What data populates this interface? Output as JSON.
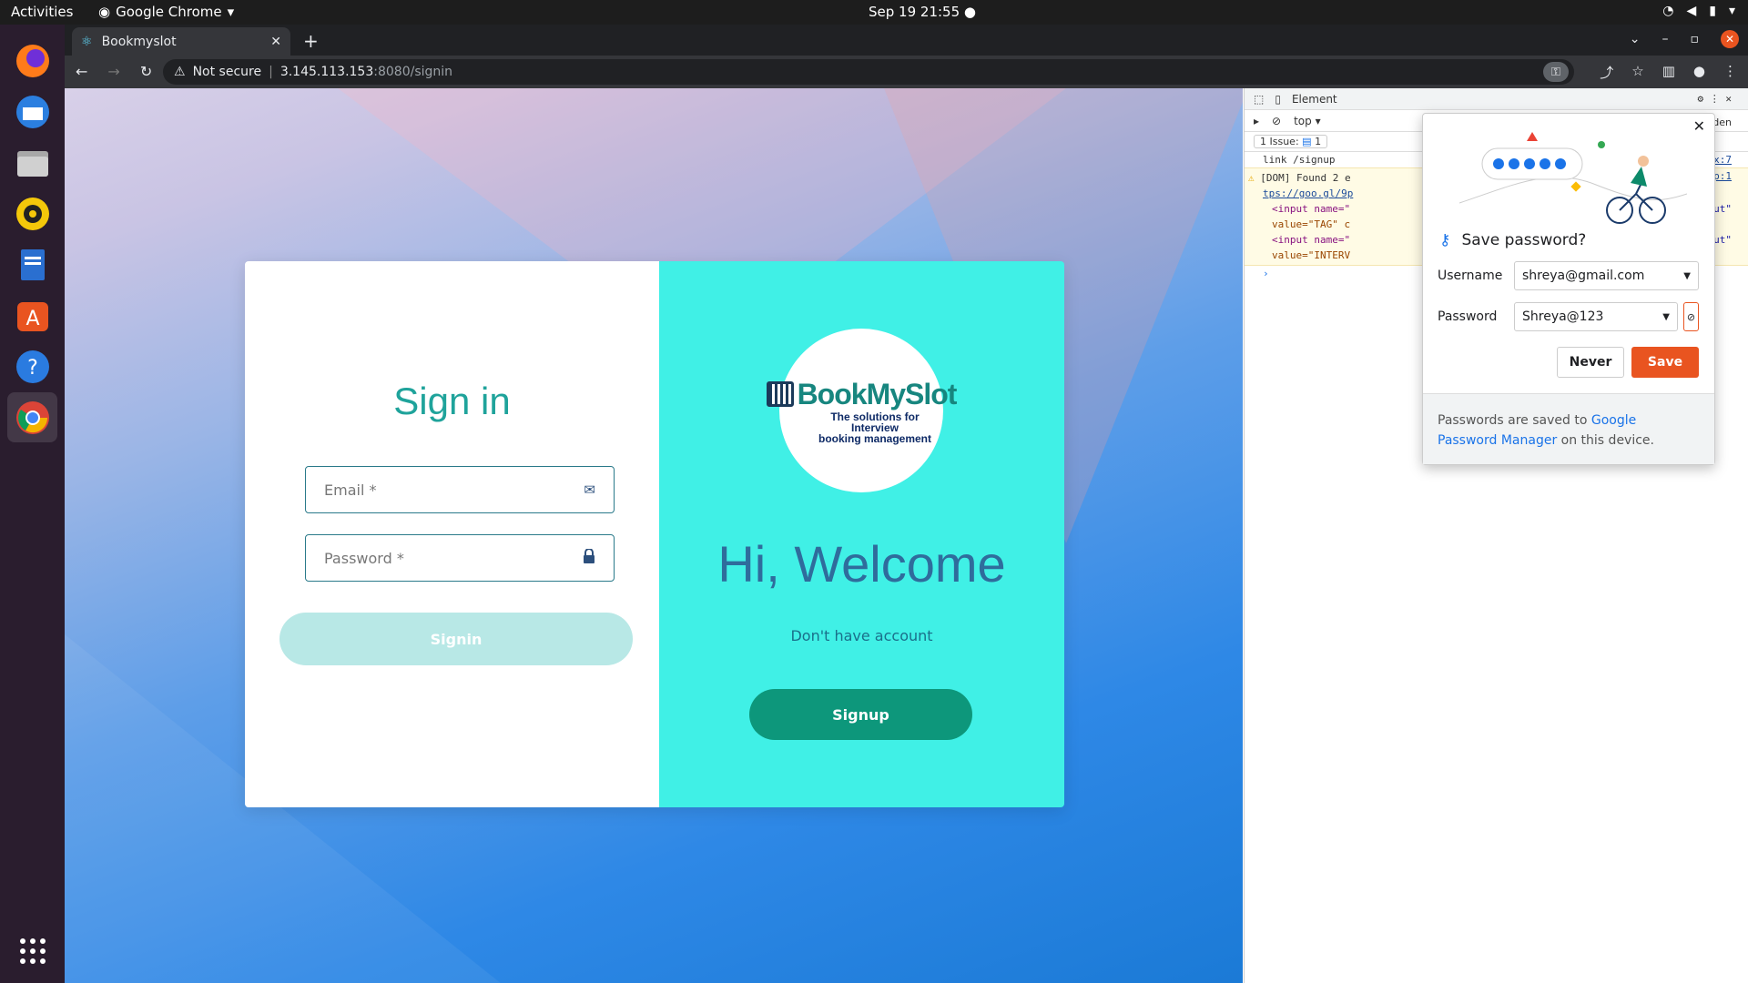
{
  "os": {
    "activities": "Activities",
    "app_name": "Google Chrome",
    "datetime": "Sep 19  21:55"
  },
  "browser": {
    "tab_title": "Bookmyslot",
    "security": "Not secure",
    "url_host": "3.145.113.153",
    "url_path": ":8080/signin"
  },
  "signin": {
    "title": "Sign in",
    "email_placeholder": "Email *",
    "password_placeholder": "Password *",
    "signin_label": "Signin"
  },
  "welcome": {
    "logo_title": "BookMySlot",
    "logo_tagline_1": "The solutions for Interview",
    "logo_tagline_2": "booking management",
    "heading": "Hi, Welcome",
    "no_account": "Don't have account",
    "signup_label": "Signup"
  },
  "devtools": {
    "tab_elements": "Element",
    "context": "top",
    "hidden": "1 hidden",
    "issue": "1 Issue:",
    "issue_count": "1",
    "log_link": "link /signup",
    "src_1": "Button.jsx:7",
    "warn_text": "[DOM] Found 2 e",
    "warn_src": "ht signup:1",
    "warn_url": "tps://goo.gl/9p",
    "code_1": "<input name=\"",
    "code_1_right": "-check-input\"",
    "code_2": "value=\"TAG\" c",
    "code_3": "<input name=\"",
    "code_3_right": "-check-input\"",
    "code_4": "value=\"INTERV"
  },
  "save_password": {
    "title": "Save password?",
    "username_label": "Username",
    "username_value": "shreya@gmail.com",
    "password_label": "Password",
    "password_value": "Shreya@123",
    "never_label": "Never",
    "save_label": "Save",
    "footer_text_1": "Passwords are saved to ",
    "footer_link": "Google Password Manager",
    "footer_text_2": " on this device."
  },
  "colors": {
    "accent": "#e95420",
    "signup": "#0d977b",
    "panel": "#40f0e6"
  }
}
